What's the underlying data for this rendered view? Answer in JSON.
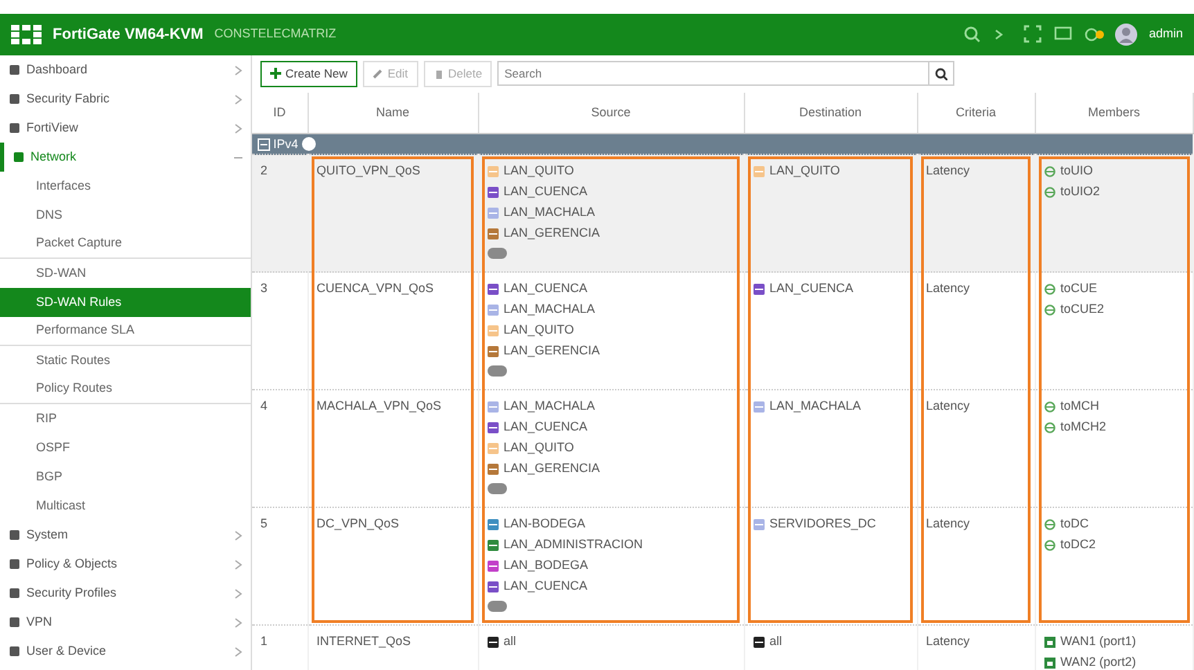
{
  "header": {
    "product": "FortiGate VM64-KVM",
    "hostname": "CONSTELECMATRIZ",
    "user": "admin"
  },
  "sidebar": [
    {
      "label": "Dashboard",
      "expanded": false
    },
    {
      "label": "Security Fabric",
      "expanded": false
    },
    {
      "label": "FortiView",
      "expanded": false
    },
    {
      "label": "Network",
      "expanded": true,
      "children": [
        {
          "label": "Interfaces",
          "selected": false
        },
        {
          "label": "DNS",
          "selected": false
        },
        {
          "label": "Packet Capture",
          "selected": false,
          "divider": true
        },
        {
          "label": "SD-WAN",
          "selected": false
        },
        {
          "label": "SD-WAN Rules",
          "selected": true
        },
        {
          "label": "Performance SLA",
          "selected": false,
          "divider": true
        },
        {
          "label": "Static Routes",
          "selected": false
        },
        {
          "label": "Policy Routes",
          "selected": false,
          "divider": true
        },
        {
          "label": "RIP",
          "selected": false
        },
        {
          "label": "OSPF",
          "selected": false
        },
        {
          "label": "BGP",
          "selected": false
        },
        {
          "label": "Multicast",
          "selected": false
        }
      ]
    },
    {
      "label": "System",
      "expanded": false
    },
    {
      "label": "Policy & Objects",
      "expanded": false
    },
    {
      "label": "Security Profiles",
      "expanded": false
    },
    {
      "label": "VPN",
      "expanded": false
    },
    {
      "label": "User & Device",
      "expanded": false
    }
  ],
  "toolbar": {
    "buttons": [
      {
        "label": "Create New",
        "disabled": false
      },
      {
        "label": "Edit",
        "disabled": true
      },
      {
        "label": "Delete",
        "disabled": true
      }
    ],
    "search": {
      "placeholder": "Search"
    }
  },
  "table": {
    "columns": [
      {
        "label": "ID",
        "highlighted": false
      },
      {
        "label": "Name",
        "highlighted": true
      },
      {
        "label": "Source",
        "highlighted": true
      },
      {
        "label": "Destination",
        "highlighted": true
      },
      {
        "label": "Criteria",
        "highlighted": true
      },
      {
        "label": "Members",
        "highlighted": true
      }
    ],
    "group": {
      "label": "IPv4",
      "expanded": true
    },
    "rows": [
      {
        "id": "2",
        "name": "QUITO_VPN_QoS",
        "selected": true,
        "more": true,
        "highlighted": true,
        "source": [
          {
            "label": "LAN_QUITO",
            "color": "#f6c48a"
          },
          {
            "label": "LAN_CUENCA",
            "color": "#7a4fc7"
          },
          {
            "label": "LAN_MACHALA",
            "color": "#a9b4e6"
          },
          {
            "label": "LAN_GERENCIA",
            "color": "#b5783a"
          }
        ],
        "destination": [
          {
            "label": "LAN_QUITO",
            "color": "#f6c48a"
          }
        ],
        "criteria": "Latency",
        "members": [
          {
            "label": "toUIO",
            "kind": "tunnel"
          },
          {
            "label": "toUIO2",
            "kind": "tunnel"
          }
        ]
      },
      {
        "id": "3",
        "name": "CUENCA_VPN_QoS",
        "selected": false,
        "more": true,
        "highlighted": true,
        "source": [
          {
            "label": "LAN_CUENCA",
            "color": "#7a4fc7"
          },
          {
            "label": "LAN_MACHALA",
            "color": "#a9b4e6"
          },
          {
            "label": "LAN_QUITO",
            "color": "#f6c48a"
          },
          {
            "label": "LAN_GERENCIA",
            "color": "#b5783a"
          }
        ],
        "destination": [
          {
            "label": "LAN_CUENCA",
            "color": "#7a4fc7"
          }
        ],
        "criteria": "Latency",
        "members": [
          {
            "label": "toCUE",
            "kind": "tunnel"
          },
          {
            "label": "toCUE2",
            "kind": "tunnel"
          }
        ]
      },
      {
        "id": "4",
        "name": "MACHALA_VPN_QoS",
        "selected": false,
        "more": true,
        "highlighted": true,
        "source": [
          {
            "label": "LAN_MACHALA",
            "color": "#a9b4e6"
          },
          {
            "label": "LAN_CUENCA",
            "color": "#7a4fc7"
          },
          {
            "label": "LAN_QUITO",
            "color": "#f6c48a"
          },
          {
            "label": "LAN_GERENCIA",
            "color": "#b5783a"
          }
        ],
        "destination": [
          {
            "label": "LAN_MACHALA",
            "color": "#a9b4e6"
          }
        ],
        "criteria": "Latency",
        "members": [
          {
            "label": "toMCH",
            "kind": "tunnel"
          },
          {
            "label": "toMCH2",
            "kind": "tunnel"
          }
        ]
      },
      {
        "id": "5",
        "name": "DC_VPN_QoS",
        "selected": false,
        "more": true,
        "highlighted": true,
        "source": [
          {
            "label": "LAN-BODEGA",
            "color": "#3f8fc0"
          },
          {
            "label": "LAN_ADMINISTRACION",
            "color": "#2e8b3e"
          },
          {
            "label": "LAN_BODEGA",
            "color": "#c23fc9"
          },
          {
            "label": "LAN_CUENCA",
            "color": "#7a4fc7"
          }
        ],
        "destination": [
          {
            "label": "SERVIDORES_DC",
            "color": "#a9b4e6"
          }
        ],
        "criteria": "Latency",
        "members": [
          {
            "label": "toDC",
            "kind": "tunnel"
          },
          {
            "label": "toDC2",
            "kind": "tunnel"
          }
        ]
      },
      {
        "id": "1",
        "name": "INTERNET_QoS",
        "selected": false,
        "more": false,
        "highlighted": false,
        "source": [
          {
            "label": "all",
            "color": "#222222"
          }
        ],
        "destination": [
          {
            "label": "all",
            "color": "#222222"
          }
        ],
        "criteria": "Latency",
        "members": [
          {
            "label": "WAN1 (port1)",
            "kind": "port"
          },
          {
            "label": "WAN2 (port2)",
            "kind": "port"
          }
        ]
      }
    ]
  }
}
